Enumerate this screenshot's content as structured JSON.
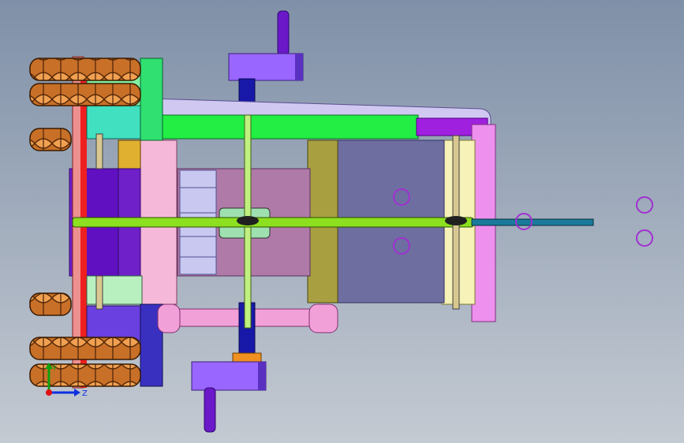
{
  "viewport": {
    "background_top": "#7f90a8",
    "background_bottom": "#c4cad2"
  },
  "triad": {
    "axis_y_label": "Y",
    "axis_z_label": "Z",
    "axis_x_color": "#e01010",
    "axis_y_color": "#10a010",
    "axis_z_color": "#1030e0"
  },
  "colors": {
    "purple": "#9966ff",
    "navy": "#2020b0",
    "bright_green": "#22ee44",
    "lavender": "#c8c0ee",
    "pink": "#f6b8d8",
    "mauve": "#b07aa8",
    "olive": "#a8a040",
    "slate": "#6e6ea0",
    "cream": "#f6f2b8",
    "violet": "#6010c0",
    "lime": "#8ce020",
    "teal": "#1a7a9a",
    "magenta_panel": "#ee90ee",
    "wheel_orange": "#d08040",
    "red_rod": "#ee2020",
    "cyan_block": "#40e0c0",
    "gold": "#e0b030"
  }
}
